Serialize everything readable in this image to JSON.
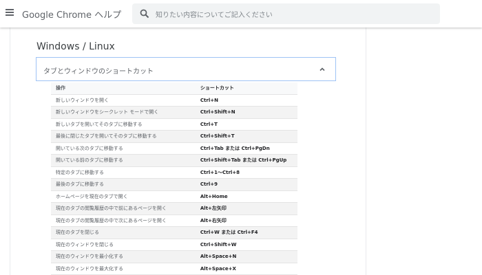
{
  "header": {
    "title": "Google Chrome ヘルプ",
    "search_placeholder": "知りたい内容についてご記入ください"
  },
  "section": {
    "title": "Windows / Linux",
    "accordion_label": "タブとウィンドウのショートカット"
  },
  "table": {
    "headers": [
      "操作",
      "ショートカット"
    ],
    "rows": [
      {
        "op": "新しいウィンドウを開く",
        "key": "Ctrl+N"
      },
      {
        "op": "新しいウィンドウをシークレット モードで開く",
        "key": "Ctrl+Shift+N"
      },
      {
        "op": "新しいタブを開いてそのタブに移動する",
        "key": "Ctrl+T"
      },
      {
        "op": "最後に閉じたタブを開いてそのタブに移動する",
        "key": "Ctrl+Shift+T"
      },
      {
        "op": "開いている次のタブに移動する",
        "key": "Ctrl+Tab または Ctrl+PgDn"
      },
      {
        "op": "開いている前のタブに移動する",
        "key": "Ctrl+Shift+Tab または Ctrl+PgUp"
      },
      {
        "op": "特定のタブに移動する",
        "key": "Ctrl+1〜Ctrl+8"
      },
      {
        "op": "最後のタブに移動する",
        "key": "Ctrl+9"
      },
      {
        "op": "ホームページを現在のタブで開く",
        "key": "Alt+Home"
      },
      {
        "op": "現在のタブの閲覧履歴の中で前にあるページを開く",
        "key": "Alt+左矢印"
      },
      {
        "op": "現在のタブの閲覧履歴の中で次にあるページを開く",
        "key": "Alt+右矢印"
      },
      {
        "op": "現在のタブを閉じる",
        "key": "Ctrl+W または Ctrl+F4"
      },
      {
        "op": "現在のウィンドウを閉じる",
        "key": "Ctrl+Shift+W"
      },
      {
        "op": "現在のウィンドウを最小化する",
        "key": "Alt+Space+N"
      },
      {
        "op": "現在のウィンドウを最大化する",
        "key": "Alt+Space+X"
      }
    ]
  },
  "colors": {
    "accent_border": "#9ec3f5",
    "search_bg": "#f1f3f4"
  },
  "icons": [
    "menu-icon",
    "search-icon",
    "chevron-up-icon"
  ]
}
